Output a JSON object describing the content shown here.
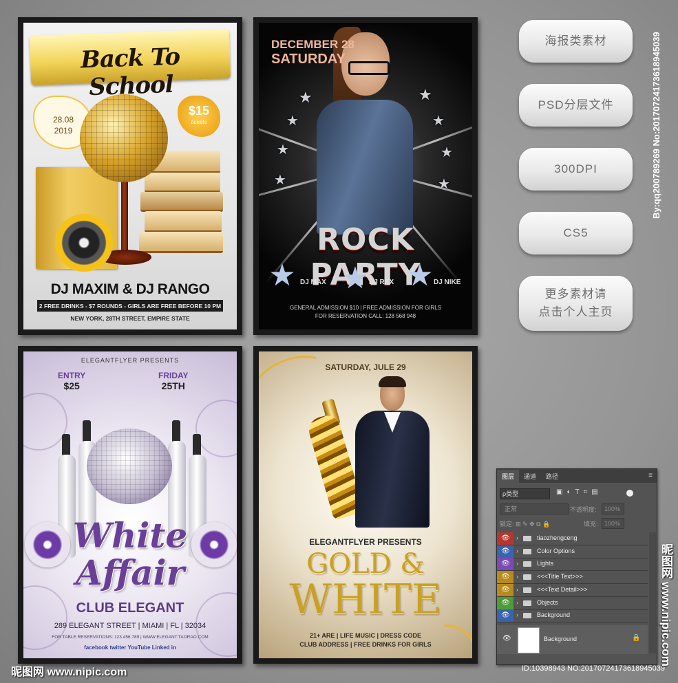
{
  "posters": [
    {
      "title": "Back To School",
      "date_line1": "28.08",
      "date_line2": "2019",
      "price": "$15",
      "price_sub": "tickets",
      "headline": "DJ MAXIM & DJ RANGO",
      "line1": "2 FREE DRINKS - $7 ROUNDS - GIRLS ARE FREE BEFORE 10 PM",
      "line2": "NEW YORK, 28TH STREET, EMPIRE STATE"
    },
    {
      "date1": "DECEMBER 28",
      "date2": "SATURDAY",
      "title": "ROCK PARTY",
      "dj1": "DJ MAX",
      "dj2": "DJ REX",
      "dj3": "DJ NIKE",
      "line1": "GENERAL ADMISSION $10  |  FREE ADMISSION FOR GIRLS",
      "line2": "FOR RESERVATION CALL: 128 568 948"
    },
    {
      "presents": "ELEGANTFLYER PRESENTS",
      "entry_label": "ENTRY",
      "entry_value": "$25",
      "day_label": "FRIDAY",
      "day_value": "25TH",
      "title1": "White",
      "title2": "Affair",
      "club": "CLUB ELEGANT",
      "address": "289 ELEGANT STREET | MIAMI | FL | 32034",
      "reservations": "FOR TABLE RESERVATIONS: 123.456.789 | WWW.ELEGANT.TAORAO.COM",
      "social": "facebook  twitter  YouTube  Linked in"
    },
    {
      "date": "SATURDAY, JULE 29",
      "presents": "ELEGANTFLYER PRESENTS",
      "title1": "GOLD &",
      "title2": "WHITE",
      "line1": "21+ ARE | LIFE MUSIC | DRESS CODE",
      "line2": "CLUB ADDRESS | FREE DRINKS FOR GIRLS"
    }
  ],
  "pills": [
    "海报类素材",
    "PSD分层文件",
    "300DPI",
    "CS5",
    "更多素材请",
    "点击个人主页"
  ],
  "vertical_text": "By:qq20078926​9  No:20170724173618945039",
  "layers_panel": {
    "tabs": [
      "图层",
      "通道",
      "路径"
    ],
    "filter": "ρ类型",
    "blend": "正常",
    "opacity_label": "不透明度:",
    "opacity_value": "100%",
    "lock_label": "锁定:",
    "fill_label": "填充:",
    "fill_value": "100%",
    "layers": [
      {
        "name": "tiaozhengceng",
        "color": "#b5362e"
      },
      {
        "name": "Color Options",
        "color": "#3a63ad"
      },
      {
        "name": "Lights",
        "color": "#7b4bb3"
      },
      {
        "name": "<<<Title Text>>>",
        "color": "#b88a1c"
      },
      {
        "name": "<<<Text Detail>>>",
        "color": "#b88a1c"
      },
      {
        "name": "Objects",
        "color": "#4f9a3a"
      },
      {
        "name": "Background",
        "color": "#3a63ad"
      }
    ],
    "bg_layer_name": "Background"
  },
  "watermark_left": "昵图网 www.nipic.com",
  "id_line": "ID:10398943 NO:20170724173618945039",
  "site_vertical": "昵图网 www.nipic.com"
}
